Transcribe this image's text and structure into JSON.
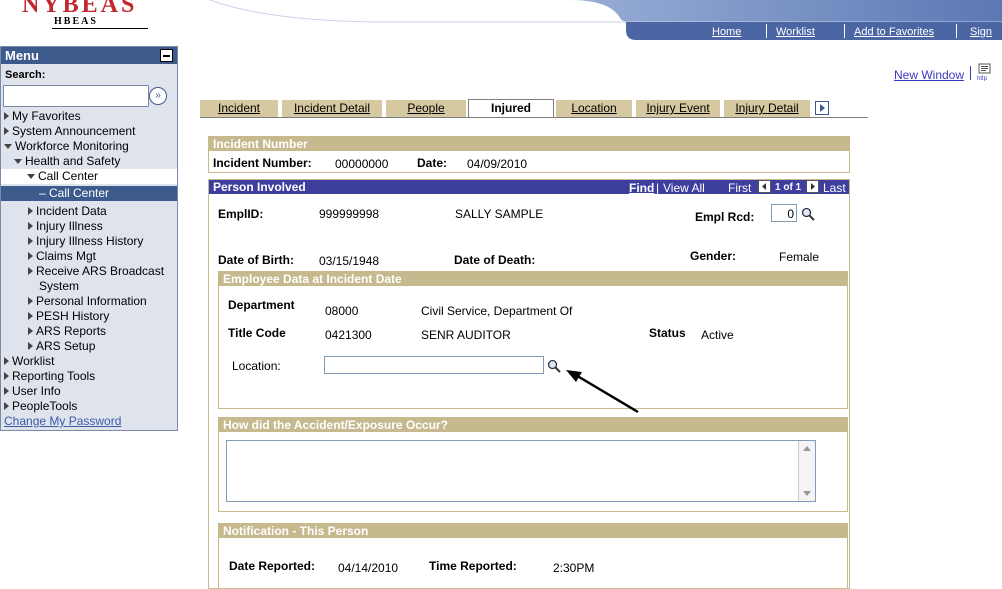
{
  "header": {
    "logo": "NYBEAS",
    "logo_sub": "HBEAS",
    "links": [
      "Home",
      "Worklist",
      "Add to Favorites",
      "Sign out"
    ],
    "new_window": "New Window"
  },
  "menu": {
    "title": "Menu",
    "search_label": "Search:",
    "search_value": "",
    "items": [
      {
        "label": "My Favorites"
      },
      {
        "label": "System Announcement"
      },
      {
        "label": "Workforce Monitoring"
      },
      {
        "label": "Health and Safety"
      },
      {
        "label": "Call Center"
      },
      {
        "label": "– Call Center"
      },
      {
        "label": "Incident Data"
      },
      {
        "label": "Injury Illness"
      },
      {
        "label": "Injury Illness History"
      },
      {
        "label": "Claims Mgt"
      },
      {
        "label": "Receive ARS Broadcast"
      },
      {
        "label": "System"
      },
      {
        "label": "Personal Information"
      },
      {
        "label": "PESH History"
      },
      {
        "label": "ARS Reports"
      },
      {
        "label": "ARS Setup"
      },
      {
        "label": "Worklist"
      },
      {
        "label": "Reporting Tools"
      },
      {
        "label": "User Info"
      },
      {
        "label": "PeopleTools"
      },
      {
        "label": "Change My Password"
      }
    ]
  },
  "tabs": [
    "Incident",
    "Incident Detail",
    "People",
    "Injured",
    "Location",
    "Injury Event",
    "Injury Detail"
  ],
  "incident": {
    "head": "Incident Number",
    "number_label": "Incident Number:",
    "number": "00000000",
    "date_label": "Date:",
    "date": "04/09/2010"
  },
  "person": {
    "head": "Person Involved",
    "find": "Find",
    "view_all": "View All",
    "first": "First",
    "count": "1 of 1",
    "last": "Last",
    "emplid_label": "EmplID:",
    "emplid": "999999998",
    "name": "SALLY SAMPLE",
    "empl_rcd_label": "Empl Rcd:",
    "empl_rcd": "0",
    "dob_label": "Date of Birth:",
    "dob": "03/15/1948",
    "dod_label": "Date of Death:",
    "gender_label": "Gender:",
    "gender": "Female"
  },
  "employee_data": {
    "head": "Employee Data at Incident Date",
    "dept_label": "Department",
    "dept_code": "08000",
    "dept_name": "Civil Service, Department Of",
    "title_label": "Title Code",
    "title_code": "0421300",
    "title_name": "SENR AUDITOR",
    "status_label": "Status",
    "status": "Active",
    "location_label": "Location:",
    "location_value": ""
  },
  "accident": {
    "head": "How did the Accident/Exposure Occur?",
    "text": ""
  },
  "notification": {
    "head": "Notification - This Person",
    "date_label": "Date Reported:",
    "date": "04/14/2010",
    "time_label": "Time Reported:",
    "time": "2:30PM"
  },
  "colors": {
    "menu_header": "#3d5a8c",
    "tab": "#d6c8a0",
    "section_head": "#c6b98e",
    "person_head": "#3e3e9e",
    "brand": "#c2262e"
  }
}
